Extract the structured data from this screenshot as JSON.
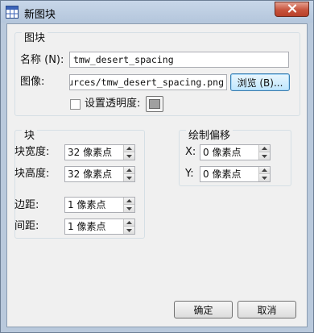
{
  "window": {
    "title": "新图块",
    "app_icon": "tileset-grid-icon",
    "close_icon": "close-icon"
  },
  "tileset_group": {
    "title": "图块",
    "name_label": "名称 (N):",
    "name_value": "tmw_desert_spacing",
    "image_label": "图像:",
    "image_value": "Resources/tmw_desert_spacing.png",
    "browse_label": "浏览 (B)...",
    "transparency_label": "设置透明度:",
    "transparency_checked": false,
    "transparency_color": "#a0a0a0"
  },
  "tiles_group": {
    "title": "块",
    "width_label": "块宽度:",
    "width_value": "32 像素点",
    "height_label": "块高度:",
    "height_value": "32 像素点",
    "margin_label": "边距:",
    "margin_value": "1 像素点",
    "spacing_label": "间距:",
    "spacing_value": "1 像素点"
  },
  "offset_group": {
    "title": "绘制偏移",
    "x_label": "X:",
    "x_value": "0 像素点",
    "y_label": "Y:",
    "y_value": "0 像素点"
  },
  "buttons": {
    "ok_label": "确定",
    "cancel_label": "取消"
  }
}
